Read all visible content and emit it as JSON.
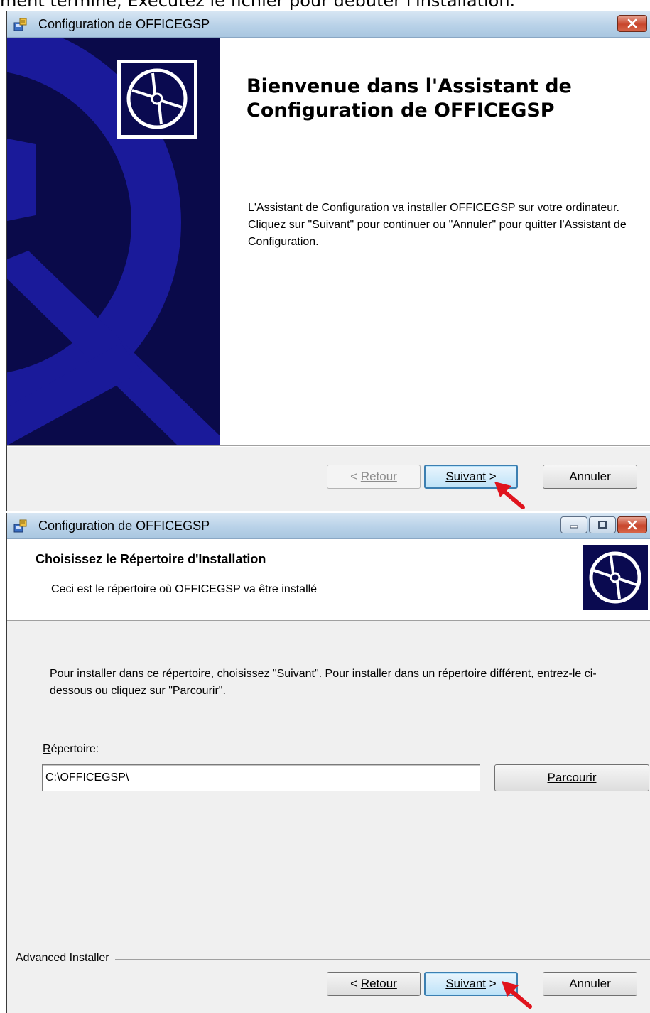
{
  "caption": "ment terminé, Exécutez le fichier pour débuter l'installation.",
  "window1": {
    "title": "Configuration de OFFICEGSP",
    "welcome_title": "Bienvenue dans l'Assistant de Configuration de OFFICEGSP",
    "welcome_text": "L'Assistant de Configuration va installer OFFICEGSP sur votre ordinateur. Cliquez sur \"Suivant\" pour continuer ou \"Annuler\" pour quitter l'Assistant de Configuration.",
    "buttons": {
      "back": "Retour",
      "next": "Suivant",
      "cancel": "Annuler"
    }
  },
  "window2": {
    "title": "Configuration de OFFICEGSP",
    "header_title": "Choisissez le Répertoire d'Installation",
    "header_subtitle": "Ceci est le répertoire où OFFICEGSP va être installé",
    "instructions": "Pour installer dans ce répertoire, choisissez \"Suivant\". Pour installer dans un répertoire différent, entrez-le ci-dessous ou cliquez sur \"Parcourir\".",
    "directory_label": "Répertoire:",
    "directory_value": "C:\\OFFICEGSP\\",
    "browse_button": "Parcourir",
    "footer_group": "Advanced Installer",
    "buttons": {
      "back": "Retour",
      "next": "Suivant",
      "cancel": "Annuler"
    }
  },
  "colors": {
    "art_bg": "#0a0a4a",
    "art_shape": "#1a1a9a",
    "annotation_arrow": "#e0141e",
    "default_button_border": "#3c7fb1"
  },
  "icons": [
    "installer-app-icon",
    "disc-icon",
    "close-icon",
    "minimize-icon",
    "maximize-icon",
    "red-arrow-annotation"
  ]
}
